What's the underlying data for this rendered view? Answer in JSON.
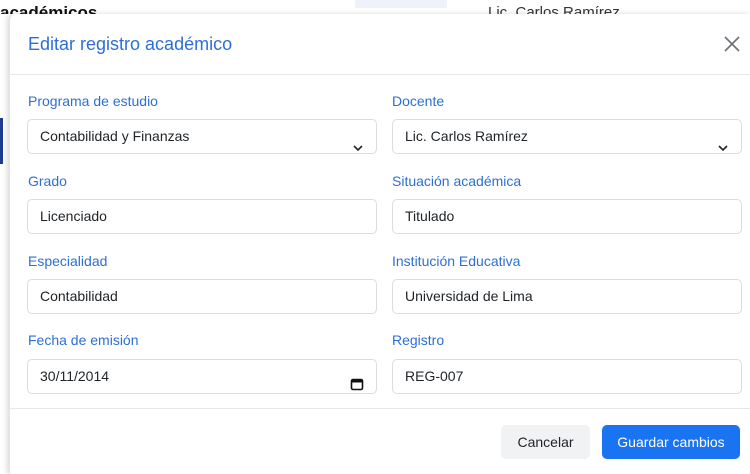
{
  "background": {
    "heading_fragment": "académicos",
    "cell_fragment": "Lic. Carlos Ramírez"
  },
  "modal": {
    "title": "Editar registro académico",
    "close_icon": "close-icon",
    "fields": {
      "programa": {
        "label": "Programa de estudio",
        "value": "Contabilidad y Finanzas"
      },
      "docente": {
        "label": "Docente",
        "value": "Lic. Carlos Ramírez"
      },
      "grado": {
        "label": "Grado",
        "value": "Licenciado"
      },
      "situacion": {
        "label": "Situación académica",
        "value": "Titulado"
      },
      "especialidad": {
        "label": "Especialidad",
        "value": "Contabilidad"
      },
      "institucion": {
        "label": "Institución Educativa",
        "value": "Universidad de Lima"
      },
      "fecha": {
        "label": "Fecha de emisión",
        "value": "30/11/2014"
      },
      "registro": {
        "label": "Registro",
        "value": "REG-007"
      }
    },
    "footer": {
      "cancel_label": "Cancelar",
      "save_label": "Guardar cambios"
    }
  },
  "colors": {
    "accent": "#2d6fd6",
    "primary_button": "#1a73f0",
    "cancel_button": "#f1f2f4"
  }
}
